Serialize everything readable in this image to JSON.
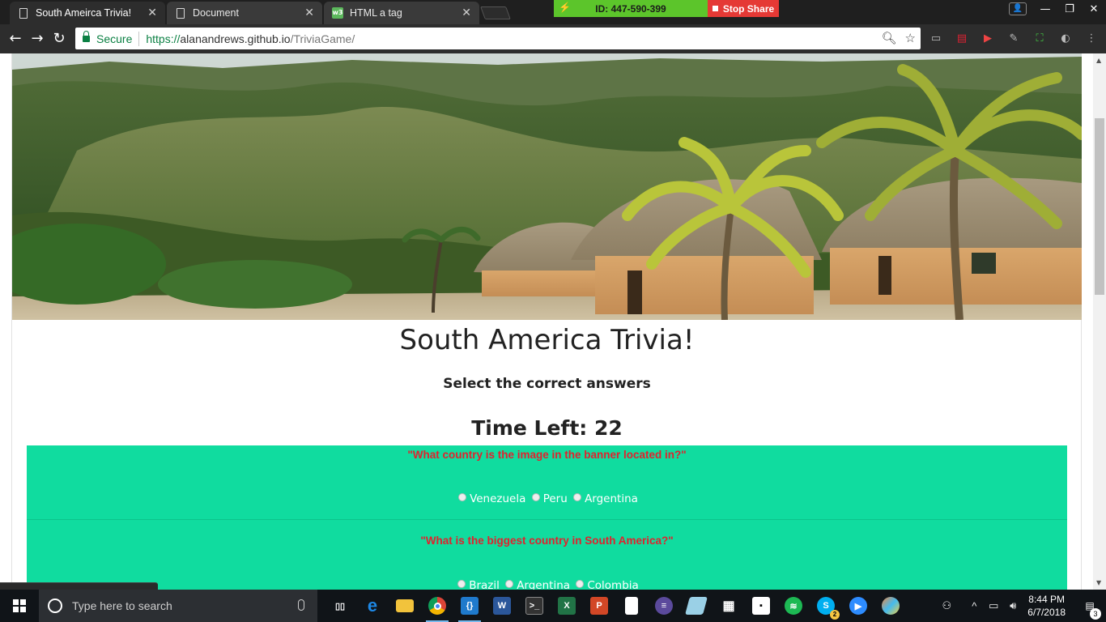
{
  "browser": {
    "tabs": [
      {
        "label": "South Ameirca Trivia!",
        "close": "✕"
      },
      {
        "label": "Document",
        "close": "✕"
      },
      {
        "label": "HTML a tag",
        "close": "✕"
      }
    ],
    "share_id": "ID: 447-590-399",
    "stop_share": "Stop Share",
    "secure_label": "Secure",
    "url_scheme": "https://",
    "url_host": "alanandrews.github.io",
    "url_path": "/TriviaGame/"
  },
  "page": {
    "title": "South America Trivia!",
    "subtitle": "Select the correct answers",
    "timer_label": "Time Left: 22",
    "questions": [
      {
        "text": "\"What country is the image in the banner located in?\"",
        "options": [
          "Venezuela",
          "Peru",
          "Argentina"
        ]
      },
      {
        "text": "\"What is the biggest country in South America?\"",
        "options": [
          "Brazil",
          "Argentina",
          "Colombia"
        ]
      }
    ]
  },
  "taskbar": {
    "search_placeholder": "Type here to search",
    "time": "8:44 PM",
    "date": "6/7/2018",
    "notification_count": "3",
    "skype_badge": "2"
  },
  "colors": {
    "quiz_bg": "#10dc9f",
    "question_text": "#e0222d",
    "option_text": "#ffffff",
    "secure_green": "#0b8043",
    "share_green": "#5cc52b",
    "stop_red": "#e53935"
  }
}
